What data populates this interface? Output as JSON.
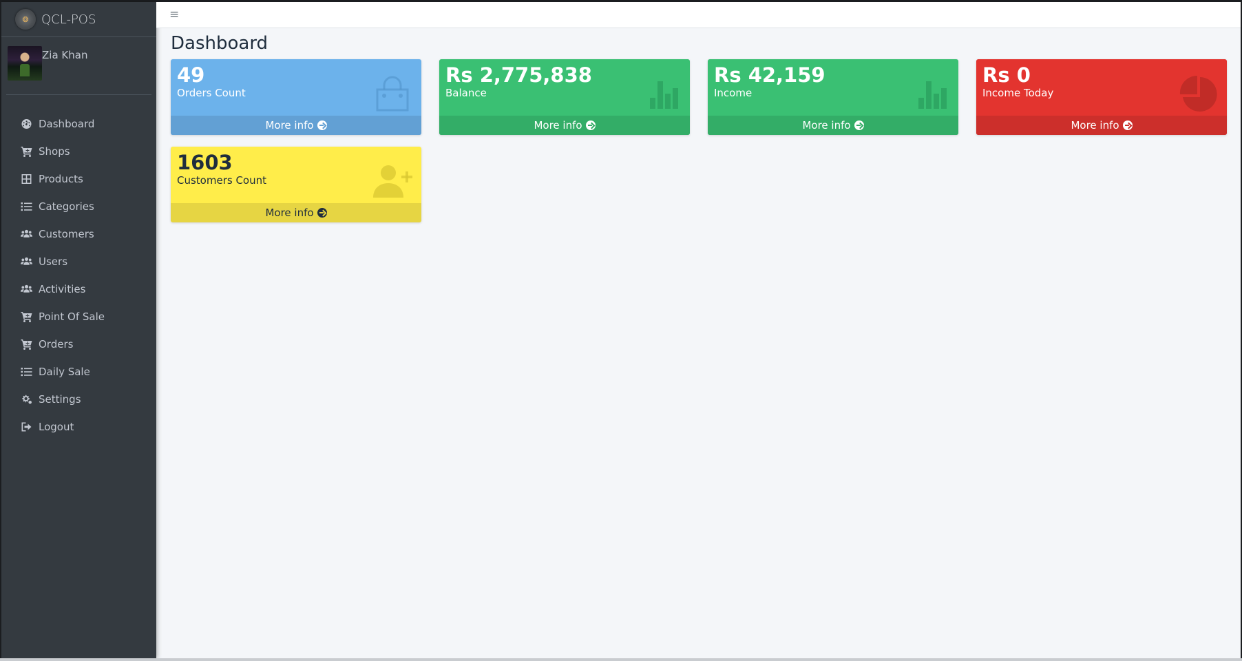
{
  "app": {
    "title": "QCL-POS"
  },
  "user": {
    "name": "Zia Khan"
  },
  "sidebar": {
    "items": [
      {
        "label": "Dashboard",
        "icon": "dashboard-icon"
      },
      {
        "label": "Shops",
        "icon": "cart-icon"
      },
      {
        "label": "Products",
        "icon": "grid-icon"
      },
      {
        "label": "Categories",
        "icon": "list-icon"
      },
      {
        "label": "Customers",
        "icon": "users-icon"
      },
      {
        "label": "Users",
        "icon": "users-icon"
      },
      {
        "label": "Activities",
        "icon": "users-icon"
      },
      {
        "label": "Point Of Sale",
        "icon": "cart-icon"
      },
      {
        "label": "Orders",
        "icon": "cart-icon"
      },
      {
        "label": "Daily Sale",
        "icon": "list-icon"
      },
      {
        "label": "Settings",
        "icon": "gears-icon"
      },
      {
        "label": "Logout",
        "icon": "logout-icon"
      }
    ]
  },
  "header": {
    "menu_icon": "hamburger-icon"
  },
  "main": {
    "title": "Dashboard",
    "boxes": [
      {
        "value": "49",
        "label": "Orders Count",
        "footer": "More info",
        "icon": "shopping-bag-icon",
        "color": "#6cb2eb"
      },
      {
        "value": "Rs 2,775,838",
        "label": "Balance",
        "footer": "More info",
        "icon": "bar-chart-icon",
        "color": "#3ac073"
      },
      {
        "value": "Rs 42,159",
        "label": "Income",
        "footer": "More info",
        "icon": "bar-chart-icon",
        "color": "#3ac073"
      },
      {
        "value": "Rs 0",
        "label": "Income Today",
        "footer": "More info",
        "icon": "pie-chart-icon",
        "color": "#e3342f"
      },
      {
        "value": "1603",
        "label": "Customers Count",
        "footer": "More info",
        "icon": "user-plus-icon",
        "color": "#ffed4a"
      }
    ]
  }
}
